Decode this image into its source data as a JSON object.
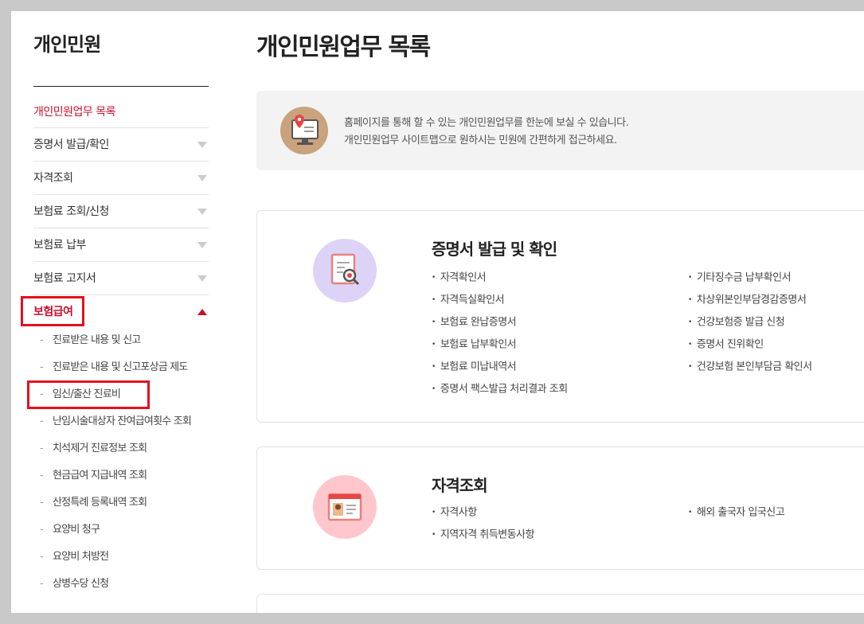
{
  "sidebar": {
    "title": "개인민원",
    "items": [
      {
        "label": "개인민원업무 목록"
      },
      {
        "label": "증명서 발급/확인"
      },
      {
        "label": "자격조회"
      },
      {
        "label": "보험료 조회/신청"
      },
      {
        "label": "보험료 납부"
      },
      {
        "label": "보험료 고지서"
      },
      {
        "label": "보험급여"
      }
    ],
    "sub_items": [
      {
        "label": "진료받은 내용 및 신고"
      },
      {
        "label": "진료받은 내용 및 신고포상금 제도"
      },
      {
        "label": "임신/출산 진료비"
      },
      {
        "label": "난임시술대상자 잔여급여횟수 조회"
      },
      {
        "label": "치석제거 진료정보 조회"
      },
      {
        "label": "현금급여 지급내역 조회"
      },
      {
        "label": "산정특례 등록내역 조회"
      },
      {
        "label": "요양비 청구"
      },
      {
        "label": "요양비 처방전"
      },
      {
        "label": "상병수당 신청"
      }
    ]
  },
  "main": {
    "title": "개인민원업무 목록",
    "info": {
      "line1": "홈페이지를 통해 할 수 있는 개인민원업무를 한눈에 보실 수 있습니다.",
      "line2": "개인민원업무 사이트맵으로 원하시는 민원에 간편하게 접근하세요."
    },
    "cards": [
      {
        "title": "증명서 발급 및 확인",
        "left": [
          "자격확인서",
          "자격득실확인서",
          "보험료 완납증명서",
          "보험료 납부확인서",
          "보험료 미납내역서",
          "증명서 팩스발급 처리결과 조회"
        ],
        "right": [
          "기타징수금 납부확인서",
          "차상위본인부담경감증명서",
          "건강보험증 발급 신청",
          "증명서 진위확인",
          "건강보험 본인부담금 확인서"
        ]
      },
      {
        "title": "자격조회",
        "left": [
          "자격사항",
          "지역자격 취득변동사항"
        ],
        "right": [
          "해외 출국자 입국신고"
        ]
      }
    ]
  },
  "colors": {
    "accent": "#c8102e",
    "highlight_box": "#e3101e"
  }
}
